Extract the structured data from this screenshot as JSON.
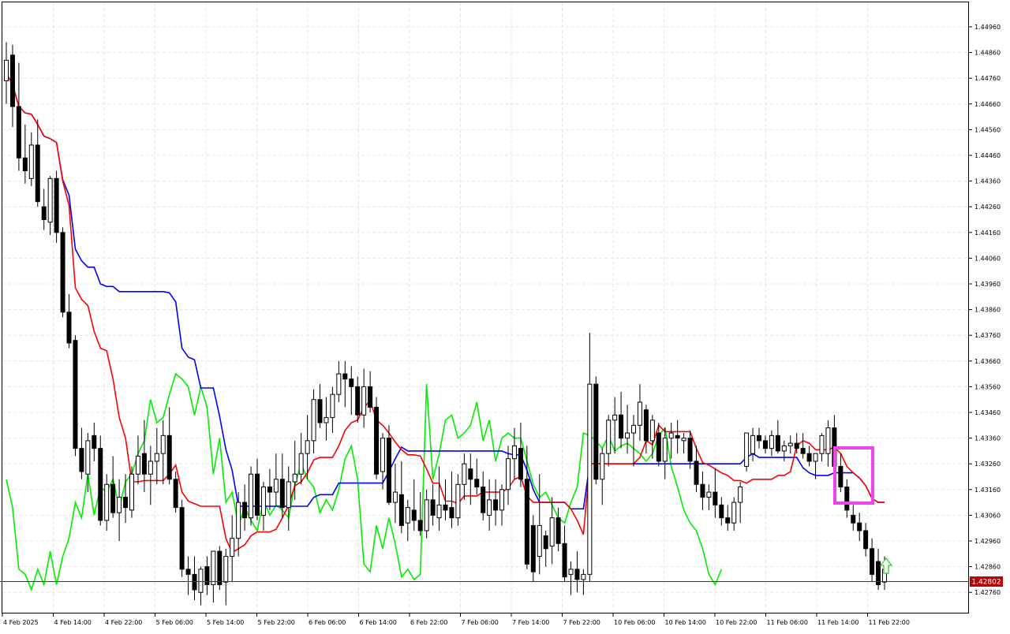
{
  "chart_data": {
    "type": "candlestick",
    "indicator": "Ichimoku",
    "price_axis": {
      "ticks": [
        "1.44960",
        "1.44860",
        "1.44760",
        "1.44660",
        "1.44560",
        "1.44460",
        "1.44360",
        "1.44260",
        "1.44160",
        "1.44060",
        "1.43960",
        "1.43860",
        "1.43760",
        "1.43660",
        "1.43560",
        "1.43460",
        "1.43360",
        "1.43260",
        "1.43160",
        "1.43060",
        "1.42960",
        "1.42860",
        "1.42760"
      ],
      "range": [
        1.427,
        1.4502
      ]
    },
    "time_axis": {
      "ticks": [
        "4 Feb 2025",
        "4 Feb 14:00",
        "4 Feb 22:00",
        "5 Feb 06:00",
        "5 Feb 14:00",
        "5 Feb 22:00",
        "6 Feb 06:00",
        "6 Feb 14:00",
        "6 Feb 22:00",
        "7 Feb 06:00",
        "7 Feb 14:00",
        "7 Feb 22:00",
        "10 Feb 06:00",
        "10 Feb 14:00",
        "10 Feb 22:00",
        "11 Feb 06:00",
        "11 Feb 14:00",
        "11 Feb 22:00"
      ]
    },
    "current_price": {
      "label": "1.42802",
      "value": 1.42802
    },
    "candles": [
      [
        1.4475,
        1.449,
        1.4466,
        1.4483
      ],
      [
        1.4485,
        1.4489,
        1.4457,
        1.4465
      ],
      [
        1.4465,
        1.4482,
        1.444,
        1.4445
      ],
      [
        1.4445,
        1.4458,
        1.4435,
        1.444
      ],
      [
        1.4437,
        1.4455,
        1.4434,
        1.445
      ],
      [
        1.445,
        1.446,
        1.4426,
        1.4428
      ],
      [
        1.4426,
        1.4433,
        1.4417,
        1.4421
      ],
      [
        1.442,
        1.4438,
        1.4415,
        1.4437
      ],
      [
        1.4437,
        1.444,
        1.4412,
        1.4416
      ],
      [
        1.4416,
        1.4418,
        1.4383,
        1.4385
      ],
      [
        1.4385,
        1.4392,
        1.4371,
        1.4373
      ],
      [
        1.4374,
        1.4376,
        1.4329,
        1.4332
      ],
      [
        1.4332,
        1.434,
        1.432,
        1.4323
      ],
      [
        1.4322,
        1.4338,
        1.4315,
        1.4335
      ],
      [
        1.4337,
        1.4342,
        1.4327,
        1.4332
      ],
      [
        1.4332,
        1.4337,
        1.4302,
        1.4304
      ],
      [
        1.4304,
        1.4322,
        1.43,
        1.4318
      ],
      [
        1.4318,
        1.4329,
        1.4305,
        1.4307
      ],
      [
        1.4307,
        1.432,
        1.4296,
        1.4313
      ],
      [
        1.4313,
        1.4322,
        1.4303,
        1.4309
      ],
      [
        1.4308,
        1.4325,
        1.4305,
        1.4322
      ],
      [
        1.4322,
        1.4337,
        1.4318,
        1.4329
      ],
      [
        1.433,
        1.4343,
        1.4315,
        1.4322
      ],
      [
        1.4322,
        1.4333,
        1.431,
        1.4327
      ],
      [
        1.4327,
        1.434,
        1.4318,
        1.433
      ],
      [
        1.433,
        1.4343,
        1.4318,
        1.4337
      ],
      [
        1.4337,
        1.4348,
        1.4318,
        1.432
      ],
      [
        1.432,
        1.4323,
        1.4307,
        1.4309
      ],
      [
        1.4309,
        1.4312,
        1.4282,
        1.4285
      ],
      [
        1.4285,
        1.429,
        1.4275,
        1.4283
      ],
      [
        1.4283,
        1.429,
        1.4273,
        1.4277
      ],
      [
        1.4276,
        1.4286,
        1.4271,
        1.4285
      ],
      [
        1.4286,
        1.429,
        1.4275,
        1.4279
      ],
      [
        1.4279,
        1.429,
        1.4272,
        1.4292
      ],
      [
        1.4292,
        1.4294,
        1.4277,
        1.4279
      ],
      [
        1.428,
        1.4293,
        1.4271,
        1.429
      ],
      [
        1.429,
        1.4306,
        1.428,
        1.4297
      ],
      [
        1.4297,
        1.4315,
        1.429,
        1.4311
      ],
      [
        1.4311,
        1.4318,
        1.43,
        1.4305
      ],
      [
        1.4305,
        1.4325,
        1.4302,
        1.4322
      ],
      [
        1.4322,
        1.4328,
        1.4304,
        1.4306
      ],
      [
        1.4306,
        1.4319,
        1.43,
        1.4317
      ],
      [
        1.4317,
        1.4324,
        1.4308,
        1.4315
      ],
      [
        1.4315,
        1.433,
        1.431,
        1.432
      ],
      [
        1.432,
        1.433,
        1.4305,
        1.4309
      ],
      [
        1.4309,
        1.4325,
        1.43,
        1.4319
      ],
      [
        1.4319,
        1.4335,
        1.4312,
        1.4322
      ],
      [
        1.4322,
        1.4338,
        1.4318,
        1.433
      ],
      [
        1.433,
        1.4345,
        1.432,
        1.4335
      ],
      [
        1.4335,
        1.4355,
        1.433,
        1.4351
      ],
      [
        1.4351,
        1.4357,
        1.434,
        1.4342
      ],
      [
        1.4342,
        1.4352,
        1.4335,
        1.4344
      ],
      [
        1.4344,
        1.4356,
        1.4338,
        1.4353
      ],
      [
        1.4353,
        1.4366,
        1.435,
        1.4361
      ],
      [
        1.4361,
        1.4366,
        1.4348,
        1.4359
      ],
      [
        1.4359,
        1.4364,
        1.4345,
        1.4356
      ],
      [
        1.4356,
        1.436,
        1.4342,
        1.4345
      ],
      [
        1.4345,
        1.4363,
        1.434,
        1.4356
      ],
      [
        1.4356,
        1.4362,
        1.4346,
        1.4348
      ],
      [
        1.4348,
        1.4352,
        1.432,
        1.4322
      ],
      [
        1.4323,
        1.4338,
        1.4316,
        1.4336
      ],
      [
        1.4336,
        1.4341,
        1.431,
        1.4311
      ],
      [
        1.4311,
        1.4326,
        1.4303,
        1.4315
      ],
      [
        1.4314,
        1.4327,
        1.4299,
        1.4302
      ],
      [
        1.4303,
        1.4312,
        1.4296,
        1.4309
      ],
      [
        1.4308,
        1.432,
        1.43,
        1.4304
      ],
      [
        1.4304,
        1.4315,
        1.4298,
        1.43
      ],
      [
        1.43,
        1.4316,
        1.4297,
        1.4312
      ],
      [
        1.4312,
        1.4318,
        1.4302,
        1.4306
      ],
      [
        1.4305,
        1.4325,
        1.43,
        1.431
      ],
      [
        1.431,
        1.432,
        1.4304,
        1.4308
      ],
      [
        1.4309,
        1.4323,
        1.4301,
        1.4305
      ],
      [
        1.4305,
        1.4322,
        1.4302,
        1.4318
      ],
      [
        1.4318,
        1.433,
        1.4312,
        1.4326
      ],
      [
        1.4324,
        1.433,
        1.431,
        1.432
      ],
      [
        1.432,
        1.4328,
        1.4314,
        1.4317
      ],
      [
        1.4317,
        1.4323,
        1.4304,
        1.4307
      ],
      [
        1.4306,
        1.432,
        1.43,
        1.4312
      ],
      [
        1.4312,
        1.432,
        1.4302,
        1.4308
      ],
      [
        1.4308,
        1.4318,
        1.4302,
        1.4316
      ],
      [
        1.4316,
        1.4333,
        1.431,
        1.4328
      ],
      [
        1.4328,
        1.434,
        1.432,
        1.4333
      ],
      [
        1.4332,
        1.4342,
        1.4317,
        1.432
      ],
      [
        1.432,
        1.4333,
        1.4285,
        1.4287
      ],
      [
        1.4302,
        1.4306,
        1.428,
        1.4284
      ],
      [
        1.429,
        1.4322,
        1.4283,
        1.4302
      ],
      [
        1.4298,
        1.43,
        1.4286,
        1.4293
      ],
      [
        1.4294,
        1.4313,
        1.4287,
        1.4305
      ],
      [
        1.4305,
        1.4309,
        1.4292,
        1.4295
      ],
      [
        1.4295,
        1.4302,
        1.428,
        1.4282
      ],
      [
        1.4283,
        1.4288,
        1.4275,
        1.4285
      ],
      [
        1.4285,
        1.4292,
        1.4276,
        1.4281
      ],
      [
        1.4281,
        1.4285,
        1.4275,
        1.4283
      ],
      [
        1.4283,
        1.4377,
        1.428,
        1.4357
      ],
      [
        1.4357,
        1.436,
        1.4318,
        1.432
      ],
      [
        1.432,
        1.4332,
        1.431,
        1.433
      ],
      [
        1.433,
        1.4345,
        1.4325,
        1.4343
      ],
      [
        1.4343,
        1.4352,
        1.433,
        1.4345
      ],
      [
        1.4345,
        1.4354,
        1.4332,
        1.4336
      ],
      [
        1.4336,
        1.4349,
        1.433,
        1.4338
      ],
      [
        1.4338,
        1.4345,
        1.4325,
        1.4341
      ],
      [
        1.4341,
        1.4357,
        1.4335,
        1.435
      ],
      [
        1.4347,
        1.4349,
        1.433,
        1.4335
      ],
      [
        1.4335,
        1.4345,
        1.4328,
        1.4343
      ],
      [
        1.4338,
        1.4342,
        1.4325,
        1.4327
      ],
      [
        1.4327,
        1.434,
        1.432,
        1.4336
      ],
      [
        1.4336,
        1.4342,
        1.4328,
        1.4338
      ],
      [
        1.4337,
        1.4343,
        1.433,
        1.4336
      ],
      [
        1.4335,
        1.4338,
        1.433,
        1.4336
      ],
      [
        1.4336,
        1.4339,
        1.4324,
        1.4327
      ],
      [
        1.4327,
        1.4333,
        1.4315,
        1.4318
      ],
      [
        1.4318,
        1.4323,
        1.4308,
        1.4313
      ],
      [
        1.4313,
        1.4318,
        1.4308,
        1.4315
      ],
      [
        1.4315,
        1.4324,
        1.4305,
        1.431
      ],
      [
        1.431,
        1.4313,
        1.4302,
        1.4305
      ],
      [
        1.4305,
        1.431,
        1.43,
        1.4303
      ],
      [
        1.4303,
        1.4313,
        1.43,
        1.4311
      ],
      [
        1.4311,
        1.4319,
        1.4303,
        1.4317
      ],
      [
        1.4325,
        1.4337,
        1.4323,
        1.4338
      ],
      [
        1.433,
        1.434,
        1.4327,
        1.4337
      ],
      [
        1.4337,
        1.434,
        1.4332,
        1.4335
      ],
      [
        1.4335,
        1.4337,
        1.433,
        1.4332
      ],
      [
        1.4332,
        1.4339,
        1.4329,
        1.4337
      ],
      [
        1.4337,
        1.4343,
        1.433,
        1.4331
      ],
      [
        1.4331,
        1.4335,
        1.4327,
        1.4333
      ],
      [
        1.4333,
        1.4337,
        1.433,
        1.4334
      ],
      [
        1.4334,
        1.4338,
        1.433,
        1.4332
      ],
      [
        1.4332,
        1.4338,
        1.4328,
        1.433
      ],
      [
        1.433,
        1.4333,
        1.4325,
        1.4327
      ],
      [
        1.4327,
        1.433,
        1.432,
        1.433
      ],
      [
        1.433,
        1.4338,
        1.4327,
        1.4337
      ],
      [
        1.433,
        1.4343,
        1.4325,
        1.434
      ],
      [
        1.434,
        1.4345,
        1.4322,
        1.4325
      ],
      [
        1.4325,
        1.433,
        1.4315,
        1.4317
      ],
      [
        1.4317,
        1.432,
        1.4305,
        1.4308
      ],
      [
        1.4306,
        1.431,
        1.43,
        1.4303
      ],
      [
        1.4303,
        1.4307,
        1.4296,
        1.43
      ],
      [
        1.43,
        1.4303,
        1.429,
        1.4293
      ],
      [
        1.4293,
        1.4297,
        1.428,
        1.4283
      ],
      [
        1.4288,
        1.4293,
        1.4277,
        1.4279
      ],
      [
        1.428,
        1.429,
        1.4277,
        1.4285
      ]
    ]
  }
}
